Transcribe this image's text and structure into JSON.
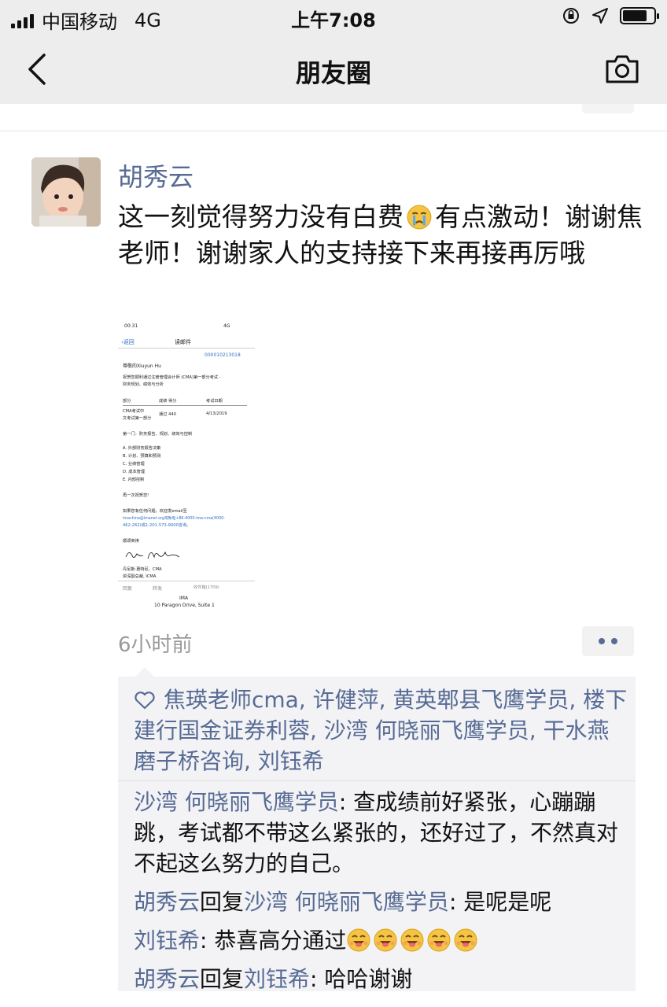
{
  "status_bar": {
    "carrier": "中国移动",
    "network": "4G",
    "time": "上午7:08"
  },
  "nav": {
    "title": "朋友圈",
    "back_icon": "chevron-left-icon",
    "camera_icon": "camera-icon"
  },
  "post": {
    "author": "胡秀云",
    "text_part1": "这一刻觉得努力没有白费",
    "text_part2": "有点激动！谢谢焦老师！谢谢家人的支持接下来再接再厉哦",
    "time": "6小时前",
    "attachment": {
      "status_time": "00:31",
      "status_right": "4G",
      "back_label": "返回",
      "header": "读邮件",
      "ref": "000010213018",
      "greeting": "尊敬的Xiuyun Hu",
      "body1": "祝贺您顺利通过注册管理会计师 (CMA)第一部分考试 -",
      "body2": "财务规划、绩效与分析",
      "col1": "部分",
      "col2": "成绩 得分",
      "col3": "考试日期",
      "row1a": "CMA考试中",
      "row1b": "文考试第一部分",
      "row_result": "通过 440",
      "row_date": "4/13/2019",
      "part_title": "第一门：财务报告、规划、绩效与控制",
      "items": [
        "A. 外部财务报告决策",
        "B. 计划、预算和预测",
        "C. 业绩管理",
        "D. 成本管理",
        "E. 内部控制"
      ],
      "congrats": "再一次祝贺您!",
      "contact1": "如果您有任何问题，欢迎发email至",
      "contact2": "imachina@imanet.org或致电+86-4000-ima-cma(4000-",
      "contact3": "462-262)或1-201-573-9000咨询。",
      "regards": "顺颂商祺",
      "sign1": "丹尼斯·惠特尼，CMA",
      "sign2": "资深副总裁, ICMA",
      "reply": "回复",
      "forward": "转发",
      "inbox": "收件箱(1709)",
      "footer1": "IMA",
      "footer2": "10 Paragon Drive, Suite 1"
    }
  },
  "likes": {
    "names": "焦瑛老师cma, 许健萍, 黄英郫县飞鹰学员, 楼下建行国金证券利蓉, 沙湾 何晓丽飞鹰学员, 干水燕磨子桥咨询, 刘钰希"
  },
  "comments": [
    {
      "name": "沙湾 何晓丽飞鹰学员",
      "text": ": 查成绩前好紧张，心蹦蹦跳，考试都不带这么紧张的，还好过了，不然真对不起这么努力的自己。"
    },
    {
      "name": "胡秀云",
      "reply_word": "回复",
      "reply_to": "沙湾 何晓丽飞鹰学员",
      "text": ": 是呢是呢"
    },
    {
      "name": "刘钰希",
      "text": ": 恭喜高分通过"
    },
    {
      "name": "胡秀云",
      "reply_word": "回复",
      "reply_to": "刘钰希",
      "text": ": 哈哈谢谢"
    }
  ],
  "colors": {
    "link": "#576b95",
    "bar_bg": "#ededed",
    "panel_bg": "#f3f3f5"
  }
}
